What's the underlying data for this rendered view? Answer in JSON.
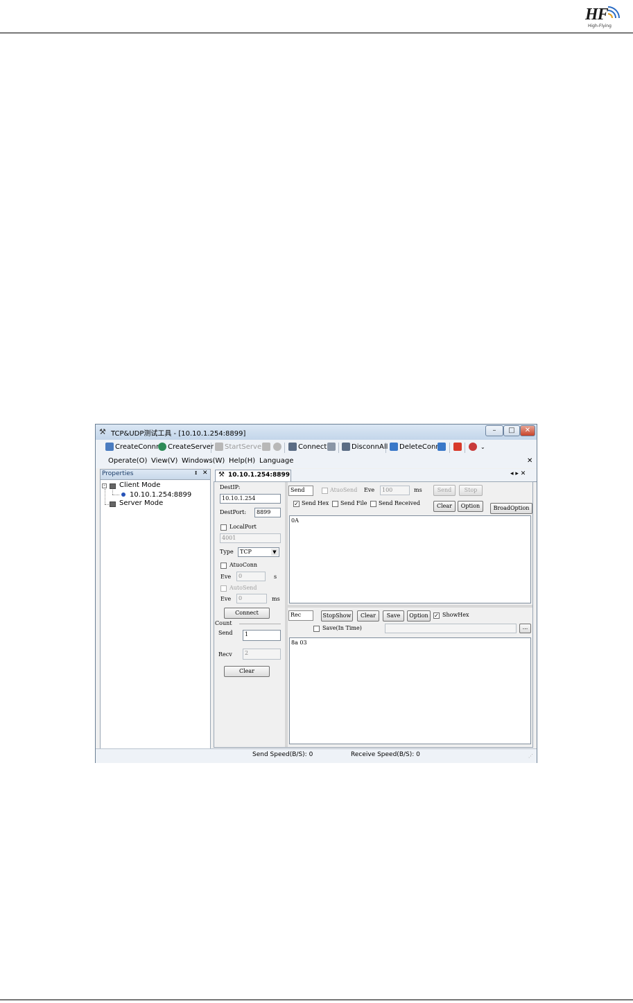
{
  "page": {
    "logo_text": "HF",
    "logo_sub": "High-Flying"
  },
  "window": {
    "title": "TCP&UDP测试工具 - [10.10.1.254:8899]",
    "toolbar": {
      "create_conn": "CreateConnn",
      "create_server": "CreateServer",
      "start_server": "StartServer",
      "connect": "Connect",
      "disconn_all": "DisconnAll",
      "delete_conn": "DeleteConn"
    },
    "menu": [
      "Operate(O)",
      "View(V)",
      "Windows(W)",
      "Help(H)",
      "Language"
    ],
    "properties": {
      "title": "Properties",
      "pin": "ᵻ",
      "close": "✕",
      "tree": {
        "client_mode": "Client Mode",
        "connection": "10.10.1.254:8899",
        "server_mode": "Server Mode"
      }
    },
    "tab": {
      "label": "10.10.1.254:8899",
      "nav": "◂ ▸ ✕"
    },
    "left_panel": {
      "dest_ip_label": "DestIP:",
      "dest_ip_value": "10.10.1.254",
      "dest_port_label": "DestPort:",
      "dest_port_value": "8899",
      "local_port_label": "LocalPort",
      "local_port_value": "4001",
      "type_label": "Type",
      "type_value": "TCP",
      "auto_conn_label": "AtuoConn",
      "auto_conn_eve_label": "Eve",
      "auto_conn_eve_value": "0",
      "auto_conn_unit": "s",
      "auto_send_label": "AutoSend",
      "auto_send_eve_label": "Eve",
      "auto_send_eve_value": "0",
      "auto_send_unit": "ms",
      "connect_button": "Connect",
      "count_label": "Count",
      "send_label": "Send",
      "send_value": "1",
      "recv_label": "Recv",
      "recv_value": "2",
      "clear_button": "Clear"
    },
    "send_panel": {
      "send_box_label": "Send",
      "auto_send_label": "AtuoSend",
      "eve_label": "Eve",
      "eve_value": "100",
      "ms_label": "ms",
      "send_button": "Send",
      "stop_button": "Stop",
      "send_hex_label": "Send Hex",
      "send_file_label": "Send File",
      "send_received_label": "Send Received",
      "clear_button": "Clear",
      "option_button": "Option",
      "broad_option_button": "BroadOption",
      "send_text": "0A"
    },
    "recv_panel": {
      "rec_box_label": "Rec",
      "stop_show_button": "StopShow",
      "clear_button": "Clear",
      "save_button": "Save",
      "option_button": "Option",
      "show_hex_label": "ShowHex",
      "save_in_time_label": "Save(In Time)",
      "browse_button": "...",
      "recv_text": "8a 03"
    },
    "status": {
      "send_speed": "Send Speed(B/S): 0",
      "receive_speed": "Receive Speed(B/S): 0"
    }
  }
}
